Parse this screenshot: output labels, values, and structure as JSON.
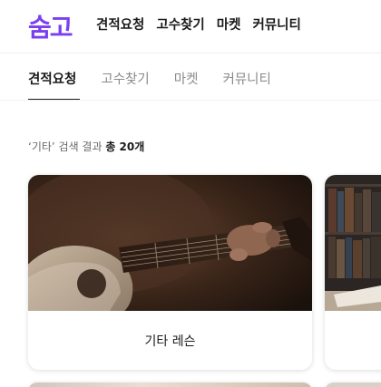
{
  "header": {
    "logo": "숨고",
    "nav": [
      "견적요청",
      "고수찾기",
      "마켓",
      "커뮤니티"
    ]
  },
  "tabs": [
    {
      "label": "견적요청",
      "active": true
    },
    {
      "label": "고수찾기",
      "active": false
    },
    {
      "label": "마켓",
      "active": false
    },
    {
      "label": "커뮤니티",
      "active": false
    }
  ],
  "search": {
    "query_text": "‘기타’ 검색 결과",
    "total_text": "총 20개"
  },
  "cards": [
    {
      "title": "기타 레슨"
    },
    {
      "title": ""
    }
  ],
  "colors": {
    "brand": "#7a3ff0",
    "text": "#1a1a1a",
    "muted": "#8a8a8a"
  }
}
